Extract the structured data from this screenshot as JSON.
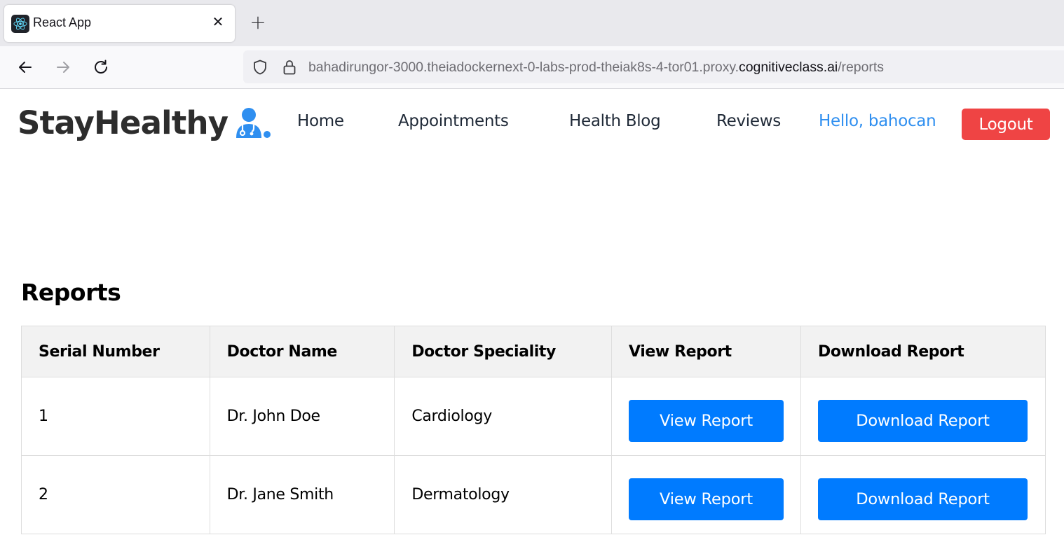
{
  "browser": {
    "tab_title": "React App",
    "close_glyph": "✕",
    "new_tab_glyph": "+",
    "url_prefix": "bahadirungor-3000.theiadockernext-0-labs-prod-theiak8s-4-tor01.proxy.",
    "url_domain": "cognitiveclass.ai",
    "url_path": "/reports",
    "icons": [
      "back-arrow-icon",
      "forward-arrow-icon",
      "reload-icon",
      "shield-icon",
      "lock-icon",
      "react-logo-icon"
    ]
  },
  "header": {
    "logo_text": "StayHealthy",
    "logo_icon": "doctor-icon",
    "nav": [
      "Home",
      "Appointments",
      "Health Blog",
      "Reviews"
    ],
    "greeting": "Hello, bahocan",
    "logout_label": "Logout"
  },
  "reports": {
    "title": "Reports",
    "columns": [
      "Serial Number",
      "Doctor Name",
      "Doctor Speciality",
      "View Report",
      "Download Report"
    ],
    "rows": [
      {
        "serial": "1",
        "doctor": "Dr. John Doe",
        "speciality": "Cardiology",
        "view_label": "View Report",
        "download_label": "Download Report"
      },
      {
        "serial": "2",
        "doctor": "Dr. Jane Smith",
        "speciality": "Dermatology",
        "view_label": "View Report",
        "download_label": "Download Report"
      }
    ]
  },
  "colors": {
    "accent_blue": "#007bff",
    "greeting_blue": "#2f8ff0",
    "logout_red": "#ef4444"
  }
}
